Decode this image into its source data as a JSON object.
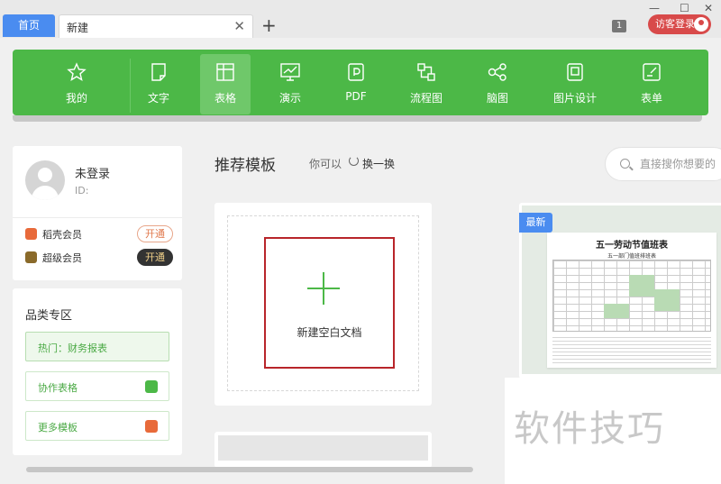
{
  "titlebar": {
    "home_tab": "首页",
    "active_tab": "新建",
    "close_glyph": "✕",
    "add_glyph": "+",
    "badge": "1",
    "visitor_login": "访客登录",
    "window_controls": [
      "—",
      "☐",
      "✕"
    ]
  },
  "toolbar": {
    "items": [
      {
        "label": "我的",
        "icon": "star-icon"
      },
      {
        "label": "文字",
        "icon": "document-icon"
      },
      {
        "label": "表格",
        "icon": "spreadsheet-icon",
        "active": true
      },
      {
        "label": "演示",
        "icon": "presentation-icon"
      },
      {
        "label": "PDF",
        "icon": "pdf-icon"
      },
      {
        "label": "流程图",
        "icon": "flowchart-icon"
      },
      {
        "label": "脑图",
        "icon": "mindmap-icon"
      },
      {
        "label": "图片设计",
        "icon": "image-design-icon"
      },
      {
        "label": "表单",
        "icon": "form-icon"
      }
    ],
    "accent": "#4cb847"
  },
  "user": {
    "name": "未登录",
    "id_label": "ID:",
    "vip": [
      {
        "label": "稻壳会员",
        "button": "开通",
        "icon_color": "#e86a3a"
      },
      {
        "label": "超级会员",
        "button": "开通",
        "icon_color": "#9a7a3a"
      }
    ]
  },
  "category": {
    "title": "品类专区",
    "items": [
      {
        "label": "热门：财务报表"
      },
      {
        "label": "协作表格",
        "icon": "layers-icon",
        "icon_color": "#4cb847"
      },
      {
        "label": "更多模板",
        "icon": "docer-icon",
        "icon_color": "#e86a3a"
      }
    ]
  },
  "main": {
    "title": "推荐模板",
    "sub": "你可以",
    "refresh_label": "换一换",
    "search_placeholder": "直接搜你想要的",
    "new_doc_label": "新建空白文档"
  },
  "template": {
    "tag": "最新",
    "title": "五一劳动节值班表",
    "subtitle": "五一部门值班排班表"
  },
  "watermark": "软件技巧"
}
